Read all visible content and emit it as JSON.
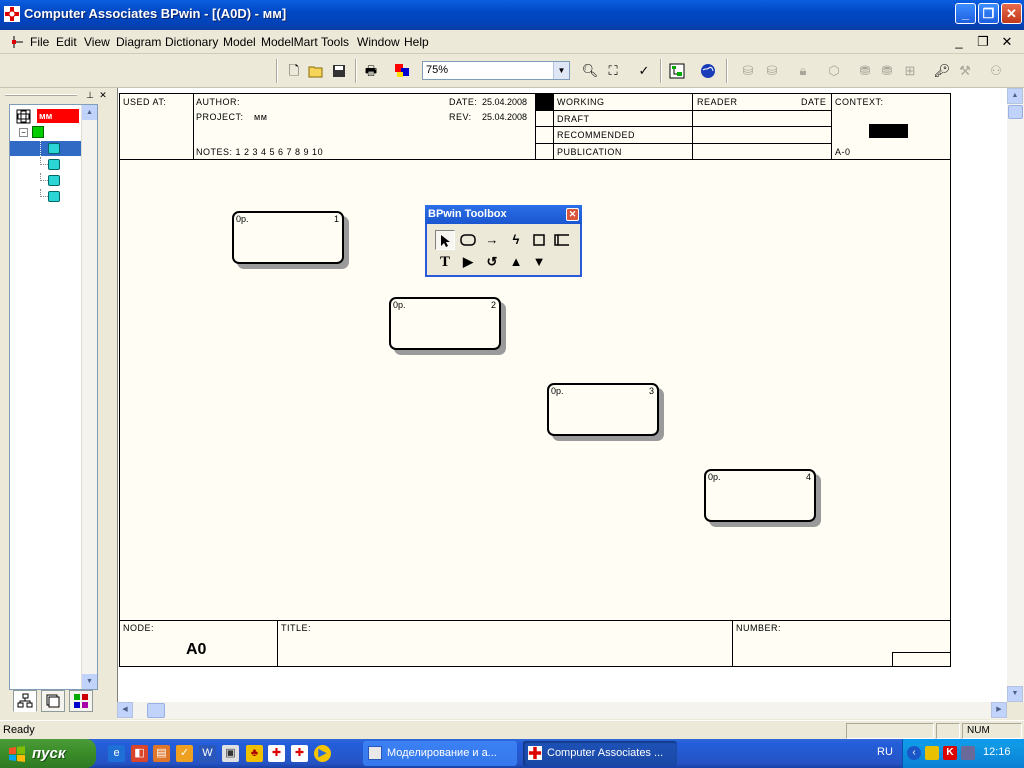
{
  "window": {
    "title": "Computer Associates BPwin - [(A0D) - мм]"
  },
  "menu": [
    "File",
    "Edit",
    "View",
    "Diagram",
    "Dictionary",
    "Model",
    "ModelMart",
    "Tools",
    "Window",
    "Help"
  ],
  "toolbar": {
    "zoom": "75%"
  },
  "tree": {
    "root_label": "мм"
  },
  "header": {
    "used_at": "USED AT:",
    "author": "AUTHOR:",
    "project_label": "PROJECT:",
    "project_value": "мм",
    "notes": "NOTES: 1 2 3 4 5 6 7 8 9 10",
    "date_label": "DATE:",
    "date_value": "25.04.2008",
    "rev_label": "REV:",
    "rev_value": "25.04.2008",
    "working": "WORKING",
    "draft": "DRAFT",
    "recommended": "RECOMMENDED",
    "publication": "PUBLICATION",
    "reader": "READER",
    "date_col": "DATE",
    "context": "CONTEXT:",
    "context_node": "A-0"
  },
  "boxes": [
    {
      "label": "0р.",
      "number": "1"
    },
    {
      "label": "0р.",
      "number": "2"
    },
    {
      "label": "0р.",
      "number": "3"
    },
    {
      "label": "0р.",
      "number": "4"
    }
  ],
  "footer": {
    "node_label": "NODE:",
    "node_value": "A0",
    "title_label": "TITLE:",
    "number_label": "NUMBER:"
  },
  "toolbox": {
    "title": "BPwin Toolbox"
  },
  "status": {
    "text": "Ready",
    "num": "NUM"
  },
  "taskbar": {
    "start": "пуск",
    "tasks": [
      "Моделирование и а...",
      "Computer Associates ..."
    ],
    "lang": "RU",
    "clock": "12:16"
  }
}
